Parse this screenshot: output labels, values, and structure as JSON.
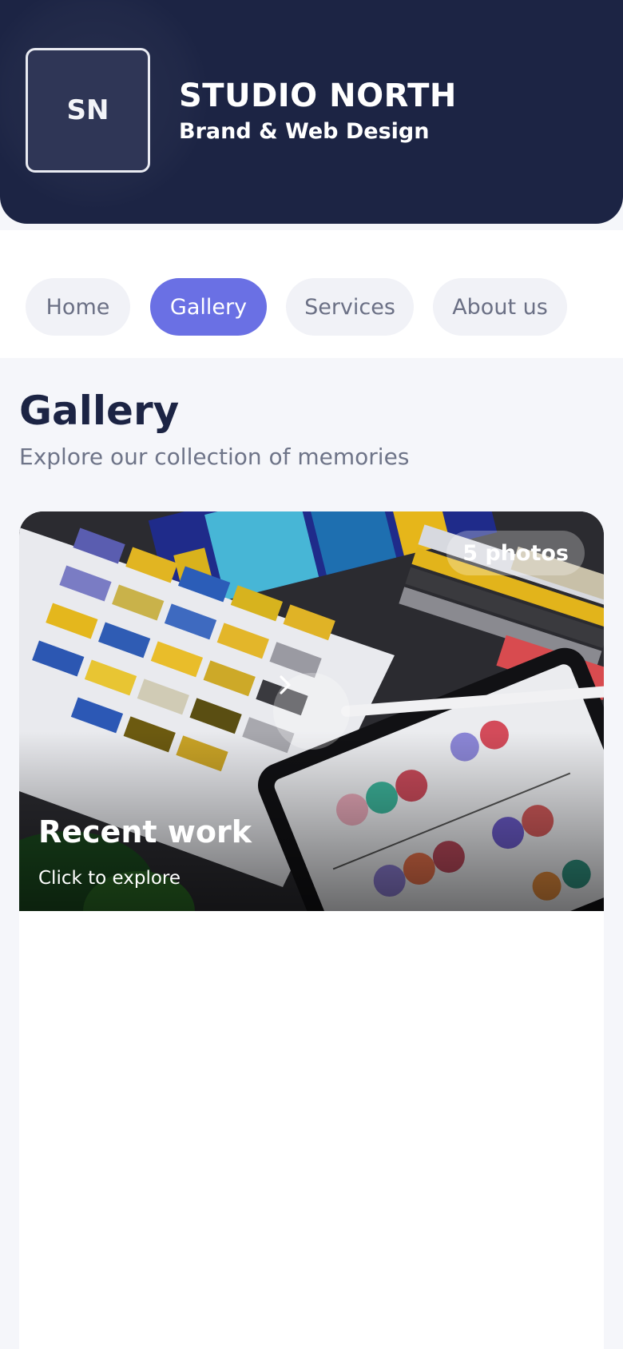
{
  "header": {
    "logo_text": "SN",
    "brand_name": "STUDIO NORTH",
    "tagline": "Brand & Web Design"
  },
  "nav": {
    "items": [
      {
        "label": "Home",
        "active": false
      },
      {
        "label": "Gallery",
        "active": true
      },
      {
        "label": "Services",
        "active": false
      },
      {
        "label": "About us",
        "active": false
      }
    ]
  },
  "page": {
    "title": "Gallery",
    "subtitle": "Explore our collection of memories"
  },
  "album": {
    "photo_count": "5 photos",
    "title": "Recent work",
    "subtitle": "Click to explore",
    "next_icon": "chevron-right-icon"
  },
  "colors": {
    "header_bg": "#1c2444",
    "accent": "#6a70e4",
    "page_bg": "#f5f6fa"
  }
}
